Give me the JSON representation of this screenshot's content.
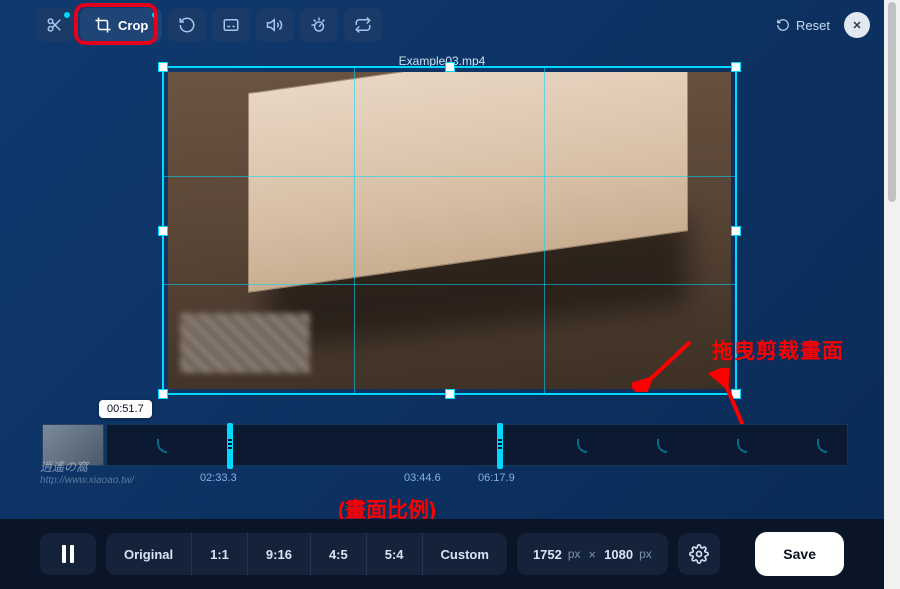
{
  "filename": "Example03.mp4",
  "toolbar": {
    "crop_label": "Crop",
    "reset_label": "Reset"
  },
  "timeline": {
    "playhead": "00:51.7",
    "t1": "02:33.3",
    "t2": "03:44.6",
    "t3": "06:17.9"
  },
  "ratios": {
    "original": "Original",
    "r11": "1:1",
    "r916": "9:16",
    "r45": "4:5",
    "r54": "5:4",
    "custom": "Custom"
  },
  "size": {
    "w": "1752",
    "wu": "px",
    "x": "×",
    "h": "1080",
    "hu": "px"
  },
  "save_label": "Save",
  "annotations": {
    "drag_crop": "拖曳剪裁畫面",
    "aspect_ratio": "(畫面比例)"
  },
  "watermark": {
    "line1": "逍遙の窩",
    "line2": "http://www.xiaoao.tw/"
  }
}
